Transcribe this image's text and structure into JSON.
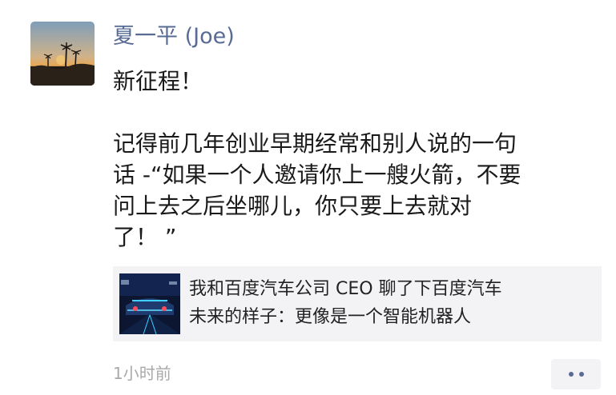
{
  "post": {
    "author": "夏一平 (Joe)",
    "text": {
      "headline": "新征程！",
      "line1": "记得前几年创业早期经常和别人说的一句",
      "line2": "话 -“如果一个人邀请你上一艘火箭，不要",
      "line3": "问上去之后坐哪儿，你只要上去就对",
      "line4": "了！ ”"
    },
    "link_card": {
      "title_line1": "我和百度汽车公司 CEO 聊了下百度汽车",
      "title_line2": "未来的样子：更像是一个智能机器人"
    },
    "timestamp": "1小时前"
  },
  "icons": {
    "avatar": "sunset-palm-photo",
    "thumbnail": "car-tech-thumbnail",
    "more": "more-dots-icon"
  },
  "colors": {
    "author": "#576b95",
    "text": "#1a1a1a",
    "card_bg": "#f3f3f5",
    "timestamp": "#a9a9a9"
  }
}
